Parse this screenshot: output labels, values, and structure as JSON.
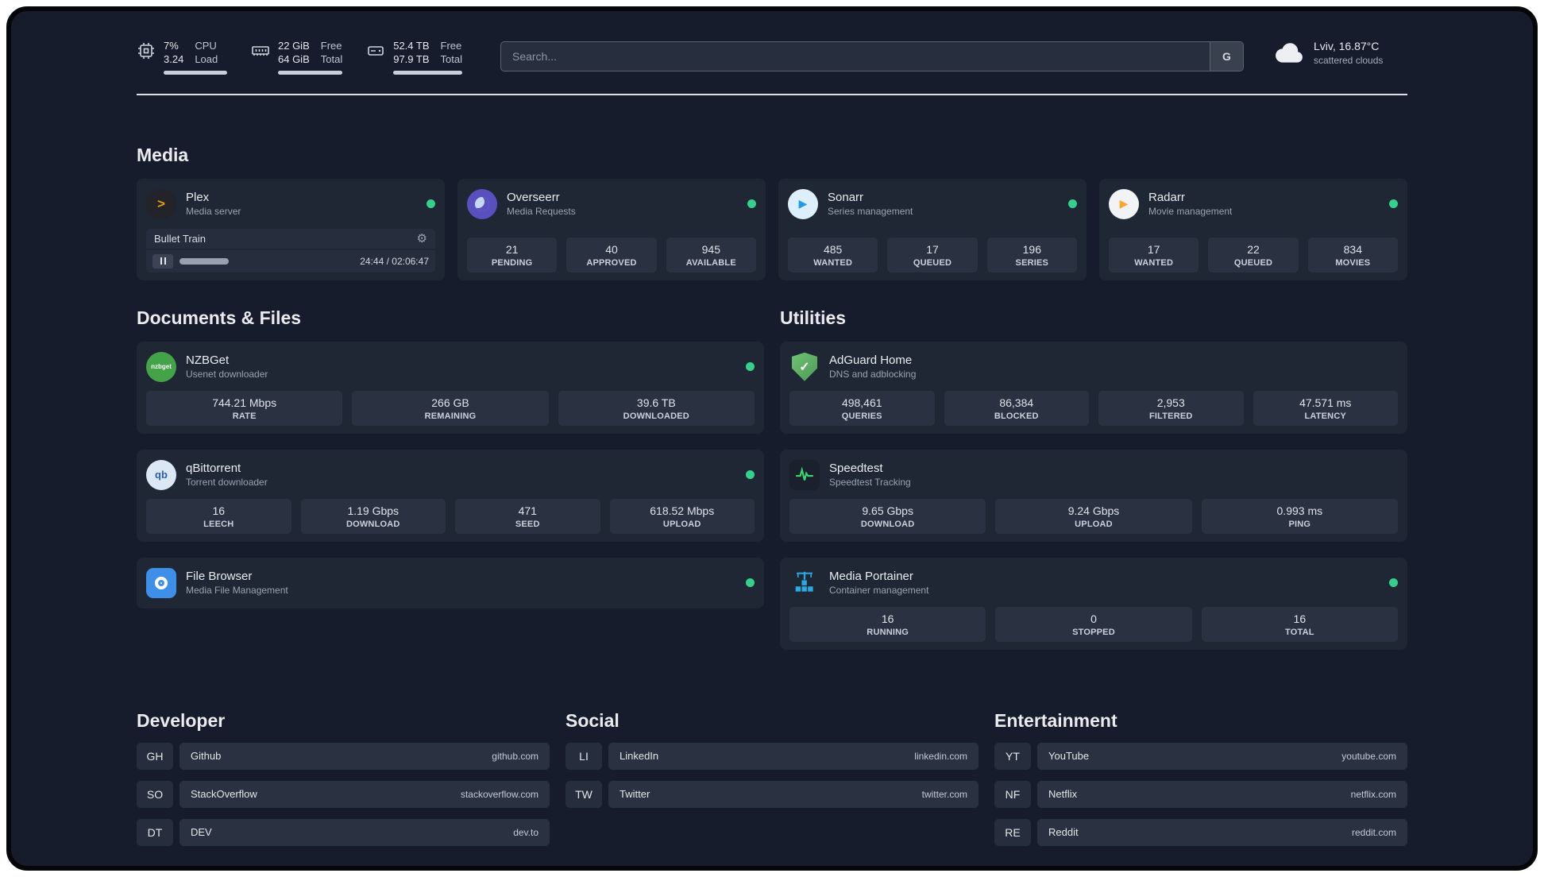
{
  "topbar": {
    "cpu": {
      "pct": "7%",
      "load": "3.24",
      "l1": "CPU",
      "l2": "Load"
    },
    "mem": {
      "v1": "22 GiB",
      "v2": "64 GiB",
      "l1": "Free",
      "l2": "Total"
    },
    "disk": {
      "v1": "52.4 TB",
      "v2": "97.9 TB",
      "l1": "Free",
      "l2": "Total"
    },
    "search": {
      "placeholder": "Search...",
      "button": "G"
    },
    "weather": {
      "location": "Lviv, 16.87°C",
      "condition": "scattered clouds"
    }
  },
  "icons": {
    "plex_glyph": ">",
    "sonarr_glyph": "▶",
    "radarr_glyph": "▶",
    "nzbget_text": "nzbget",
    "qbittorrent_text": "qb",
    "adguard_check": "✓",
    "gear": "⚙"
  },
  "colors": {
    "status_ok": "#35D08D",
    "background": "#161C2B",
    "card": "#1F2634",
    "accent_plex": "#E5A00D"
  },
  "media": {
    "title": "Media",
    "plex": {
      "name": "Plex",
      "desc": "Media server",
      "now_playing": "Bullet Train",
      "time": "24:44 / 02:06:47",
      "progress_pct": 19
    },
    "overseerr": {
      "name": "Overseerr",
      "desc": "Media Requests",
      "stats": [
        {
          "value": "21",
          "label": "PENDING"
        },
        {
          "value": "40",
          "label": "APPROVED"
        },
        {
          "value": "945",
          "label": "AVAILABLE"
        }
      ]
    },
    "sonarr": {
      "name": "Sonarr",
      "desc": "Series management",
      "stats": [
        {
          "value": "485",
          "label": "WANTED"
        },
        {
          "value": "17",
          "label": "QUEUED"
        },
        {
          "value": "196",
          "label": "SERIES"
        }
      ]
    },
    "radarr": {
      "name": "Radarr",
      "desc": "Movie management",
      "stats": [
        {
          "value": "17",
          "label": "WANTED"
        },
        {
          "value": "22",
          "label": "QUEUED"
        },
        {
          "value": "834",
          "label": "MOVIES"
        }
      ]
    }
  },
  "documents": {
    "title": "Documents & Files",
    "nzbget": {
      "name": "NZBGet",
      "desc": "Usenet downloader",
      "stats": [
        {
          "value": "744.21 Mbps",
          "label": "RATE"
        },
        {
          "value": "266 GB",
          "label": "REMAINING"
        },
        {
          "value": "39.6 TB",
          "label": "DOWNLOADED"
        }
      ]
    },
    "qbittorrent": {
      "name": "qBittorrent",
      "desc": "Torrent downloader",
      "stats": [
        {
          "value": "16",
          "label": "LEECH"
        },
        {
          "value": "1.19 Gbps",
          "label": "DOWNLOAD"
        },
        {
          "value": "471",
          "label": "SEED"
        },
        {
          "value": "618.52 Mbps",
          "label": "UPLOAD"
        }
      ]
    },
    "filebrowser": {
      "name": "File Browser",
      "desc": "Media File Management"
    }
  },
  "utilities": {
    "title": "Utilities",
    "adguard": {
      "name": "AdGuard Home",
      "desc": "DNS and adblocking",
      "stats": [
        {
          "value": "498,461",
          "label": "QUERIES"
        },
        {
          "value": "86,384",
          "label": "BLOCKED"
        },
        {
          "value": "2,953",
          "label": "FILTERED"
        },
        {
          "value": "47.571 ms",
          "label": "LATENCY"
        }
      ]
    },
    "speedtest": {
      "name": "Speedtest",
      "desc": "Speedtest Tracking",
      "stats": [
        {
          "value": "9.65 Gbps",
          "label": "DOWNLOAD"
        },
        {
          "value": "9.24 Gbps",
          "label": "UPLOAD"
        },
        {
          "value": "0.993 ms",
          "label": "PING"
        }
      ]
    },
    "portainer": {
      "name": "Media Portainer",
      "desc": "Container management",
      "stats": [
        {
          "value": "16",
          "label": "RUNNING"
        },
        {
          "value": "0",
          "label": "STOPPED"
        },
        {
          "value": "16",
          "label": "TOTAL"
        }
      ]
    }
  },
  "bookmarks": {
    "developer": {
      "title": "Developer",
      "items": [
        {
          "abbr": "GH",
          "name": "Github",
          "url": "github.com"
        },
        {
          "abbr": "SO",
          "name": "StackOverflow",
          "url": "stackoverflow.com"
        },
        {
          "abbr": "DT",
          "name": "DEV",
          "url": "dev.to"
        }
      ]
    },
    "social": {
      "title": "Social",
      "items": [
        {
          "abbr": "LI",
          "name": "LinkedIn",
          "url": "linkedin.com"
        },
        {
          "abbr": "TW",
          "name": "Twitter",
          "url": "twitter.com"
        }
      ]
    },
    "entertainment": {
      "title": "Entertainment",
      "items": [
        {
          "abbr": "YT",
          "name": "YouTube",
          "url": "youtube.com"
        },
        {
          "abbr": "NF",
          "name": "Netflix",
          "url": "netflix.com"
        },
        {
          "abbr": "RE",
          "name": "Reddit",
          "url": "reddit.com"
        }
      ]
    }
  }
}
